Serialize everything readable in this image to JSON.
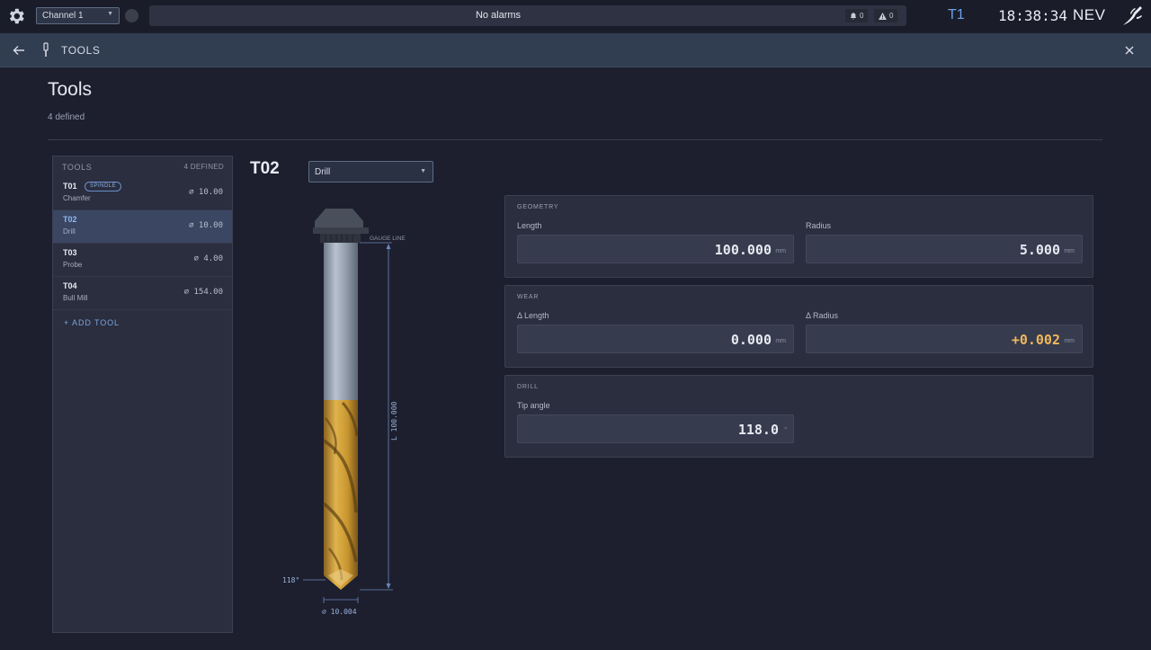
{
  "topbar": {
    "channel": "Channel 1",
    "alarm_text": "No alarms",
    "notifications_count": "0",
    "warnings_count": "0",
    "active_tool": "T1",
    "clock": "18:38:34",
    "operator": "NEV"
  },
  "pagebar": {
    "title": "TOOLS"
  },
  "page": {
    "title": "Tools",
    "subtitle": "4 defined"
  },
  "tool_list": {
    "header": "TOOLS",
    "count": "4 DEFINED",
    "tools": [
      {
        "code": "T01",
        "type": "Chamfer",
        "diameter": "⌀ 10.00",
        "badge": "SPINDLE",
        "active": false
      },
      {
        "code": "T02",
        "type": "Drill",
        "diameter": "⌀ 10.00",
        "active": true
      },
      {
        "code": "T03",
        "type": "Probe",
        "diameter": "⌀ 4.00",
        "active": false
      },
      {
        "code": "T04",
        "type": "Bull Mill",
        "diameter": "⌀ 154.00",
        "active": false
      }
    ],
    "add_label": "+ ADD TOOL"
  },
  "editor": {
    "code": "T02",
    "type": "Drill",
    "drawing": {
      "gauge_label": "GAUGE LINE",
      "length_label": "L 100.000",
      "angle_label": "118°",
      "diameter_label": "⌀ 10.004"
    },
    "geometry": {
      "title": "GEOMETRY",
      "length_label": "Length",
      "length_value": "100.000",
      "radius_label": "Radius",
      "radius_value": "5.000",
      "unit": "mm"
    },
    "wear": {
      "title": "WEAR",
      "length_label": "Δ Length",
      "length_value": "0.000",
      "radius_label": "Δ Radius",
      "radius_value": "+0.002",
      "unit": "mm"
    },
    "drill": {
      "title": "DRILL",
      "tip_label": "Tip angle",
      "tip_value": "118.0",
      "tip_unit": "°"
    }
  },
  "colors": {
    "accent": "#6aa2e6",
    "warning": "#f0b85a",
    "active_row": "#3b4663",
    "gold": "#c8962f"
  },
  "icons": [
    "gear-icon",
    "bell-icon",
    "warning-icon",
    "brand-icon",
    "back-arrow-icon",
    "tool-icon",
    "close-icon",
    "caret-down-icon"
  ]
}
